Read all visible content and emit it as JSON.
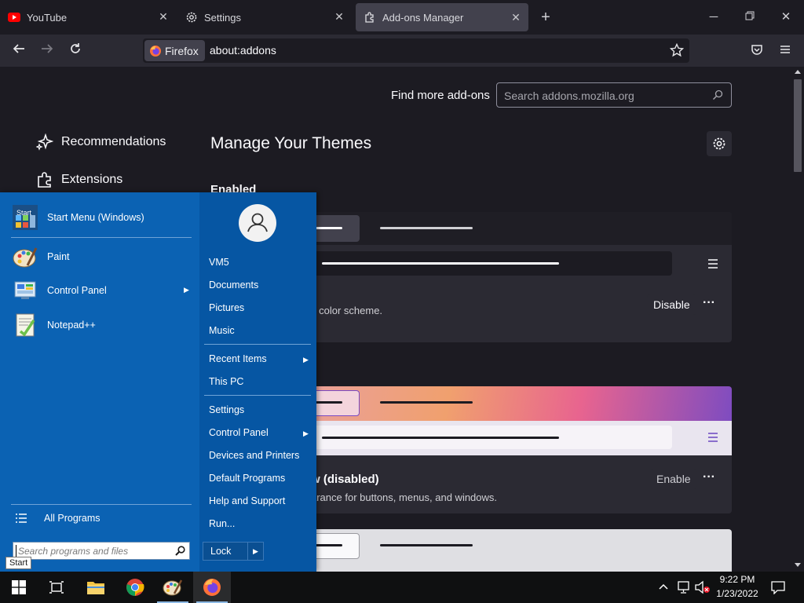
{
  "browser": {
    "tabs": [
      {
        "title": "YouTube",
        "icon": "youtube-icon",
        "active": false
      },
      {
        "title": "Settings",
        "icon": "gear-icon",
        "active": false
      },
      {
        "title": "Add-ons Manager",
        "icon": "puzzle-icon",
        "active": true
      }
    ],
    "identity_label": "Firefox",
    "url": "about:addons"
  },
  "addons": {
    "find_more_label": "Find more add-ons",
    "search_placeholder": "Search addons.mozilla.org",
    "categories": [
      {
        "label": "Recommendations",
        "icon": "sparkle-icon"
      },
      {
        "label": "Extensions",
        "icon": "puzzle-icon"
      }
    ],
    "heading": "Manage Your Themes",
    "enabled_heading": "Enabled",
    "themes": [
      {
        "title": "",
        "description": "k color scheme.",
        "action": "Disable"
      },
      {
        "title": "w (disabled)",
        "description": "arance for buttons, menus, and windows.",
        "action": "Enable"
      }
    ]
  },
  "start_menu": {
    "programs": [
      {
        "label": "Start Menu (Windows)",
        "icon": "start-menu-icon",
        "submenu": false
      },
      {
        "label": "Paint",
        "icon": "paint-icon",
        "submenu": false
      },
      {
        "label": "Control Panel",
        "icon": "control-panel-icon",
        "submenu": true
      },
      {
        "label": "Notepad++",
        "icon": "notepad-plus-icon",
        "submenu": false
      }
    ],
    "start_icon_text": "Start",
    "all_programs": "All Programs",
    "search_placeholder": "Search programs and files",
    "right_items": {
      "user": "VM5",
      "documents": "Documents",
      "pictures": "Pictures",
      "music": "Music",
      "recent_items": "Recent Items",
      "this_pc": "This PC",
      "settings": "Settings",
      "control_panel": "Control Panel",
      "devices_printers": "Devices and Printers",
      "default_programs": "Default Programs",
      "help_support": "Help and Support",
      "run": "Run..."
    },
    "lock_label": "Lock",
    "tooltip": "Start"
  },
  "taskbar": {
    "time": "9:22 PM",
    "date": "1/23/2022"
  },
  "colors": {
    "accent_startmenu": "#0b62b3",
    "firefox_bg": "#1c1b22",
    "card_bg": "#2b2a33"
  }
}
